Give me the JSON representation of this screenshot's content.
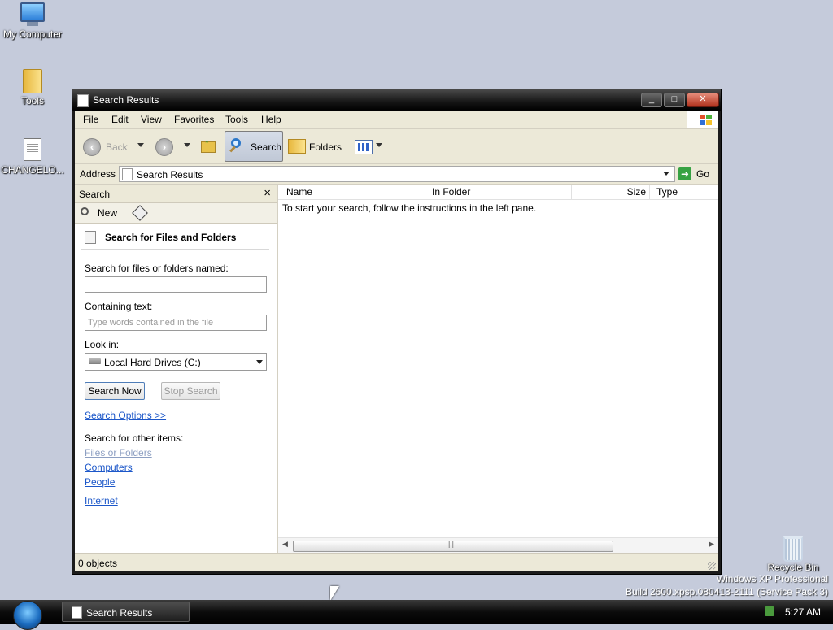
{
  "desktop": {
    "icons": [
      {
        "label": "My Computer"
      },
      {
        "label": "Tools"
      },
      {
        "label": "CHANGELO..."
      },
      {
        "label": "Recycle Bin"
      }
    ],
    "watermark_line1": "Windows XP Professional",
    "watermark_line2": "Build 2600.xpsp.080413-2111 (Service Pack 3)"
  },
  "window": {
    "title": "Search Results",
    "menu": [
      "File",
      "Edit",
      "View",
      "Favorites",
      "Tools",
      "Help"
    ],
    "toolbar": {
      "back_label": "Back",
      "search_label": "Search",
      "folders_label": "Folders"
    },
    "address": {
      "label": "Address",
      "value": "Search Results",
      "go_label": "Go"
    },
    "search_pane": {
      "header": "Search",
      "new_label": "New",
      "title": "Search for Files and Folders",
      "named_label": "Search for files or folders named:",
      "named_value": "",
      "containing_label": "Containing text:",
      "containing_placeholder": "Type words contained in the file",
      "lookin_label": "Look in:",
      "lookin_value": "Local Hard Drives (C:)",
      "search_now": "Search Now",
      "stop_search": "Stop Search",
      "search_options": "Search Options >>",
      "other_items_label": "Search for other items:",
      "other_items": [
        "Files or Folders",
        "Computers",
        "People",
        "Internet"
      ]
    },
    "results": {
      "columns": [
        "Name",
        "In Folder",
        "Size",
        "Type"
      ],
      "empty_message": "To start your search, follow the instructions in the left pane."
    },
    "status": "0 objects"
  },
  "taskbar": {
    "task_label": "Search Results",
    "clock": "5:27 AM"
  },
  "colors": {
    "desktop_bg": "#c5cbdb",
    "link": "#1c57c9",
    "chrome": "#ece9d8"
  }
}
